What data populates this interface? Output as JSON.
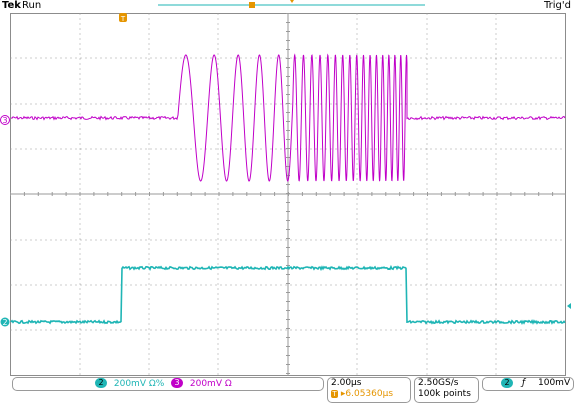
{
  "header": {
    "brand": "Tek",
    "run_state": "Run",
    "trigger_state": "Trig'd"
  },
  "markers": {
    "ch3": "3",
    "ch2": "2",
    "trigger": "T"
  },
  "colors": {
    "ch3": "#c000c8",
    "ch2": "#1fb5b5",
    "orange": "#e59500",
    "grid": "#9a9a9a",
    "frame": "#8c8c8c"
  },
  "status": {
    "ch2_badge": "2",
    "ch2_scale": "200mV Ω%",
    "ch3_badge": "3",
    "ch3_scale": "200mV Ω",
    "timebase": "2.00μs",
    "trig_badge": "T",
    "trig_offset": "▸6.05360μs",
    "sample_rate": "2.50GS/s",
    "record_length": "100k points",
    "trig_ch_badge": "2",
    "trig_slope": "ƒ",
    "trig_level": "100mV"
  }
}
